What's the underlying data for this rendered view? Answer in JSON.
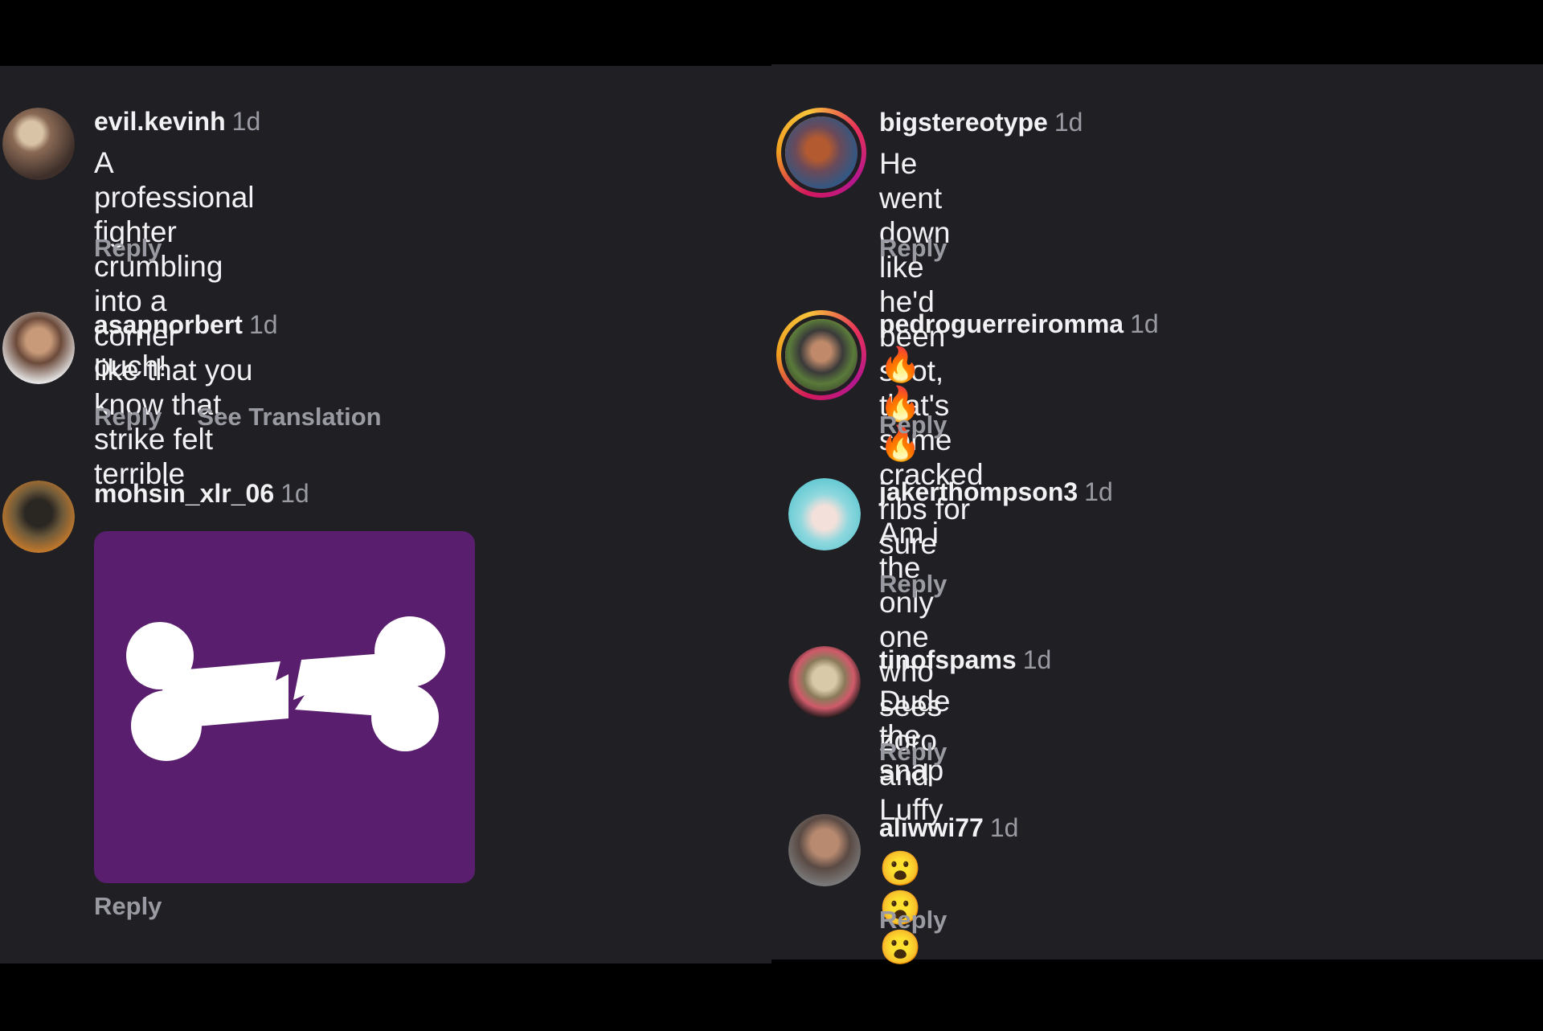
{
  "comments_left": [
    {
      "username": "evil.kevinh",
      "time": "1d",
      "text": "A professional fighter crumbling into a corner\nlike that you know that strike felt terrible",
      "reply": "Reply"
    },
    {
      "username": "asapnorbert",
      "time": "1d",
      "text": "ouch!",
      "reply": "Reply",
      "translate": "See Translation"
    },
    {
      "username": "mohsin_xlr_06",
      "time": "1d",
      "reply": "Reply",
      "media": {
        "icon": "broken-bone-icon",
        "background": "#5a1e6e"
      }
    }
  ],
  "comments_right": [
    {
      "username": "bigstereotype",
      "time": "1d",
      "text": "He went down like he'd been shot, that's some\ncracked ribs for sure",
      "reply": "Reply"
    },
    {
      "username": "pedroguerreiromma",
      "time": "1d",
      "emojis": "🔥🔥🔥",
      "reply": "Reply"
    },
    {
      "username": "jakerthompson3",
      "time": "1d",
      "text": "Am i the only one who sees zoro and Luffy",
      "reply": "Reply"
    },
    {
      "username": "tinofspams",
      "time": "1d",
      "text": "Dude the snap",
      "reply": "Reply"
    },
    {
      "username": "aliwwi77",
      "time": "1d",
      "emojis": "😮😮😮",
      "reply": "Reply"
    }
  ],
  "colors": {
    "background": "#1f1f24",
    "muted_text": "#9a9aa3",
    "primary_text": "#f2f2f4"
  }
}
